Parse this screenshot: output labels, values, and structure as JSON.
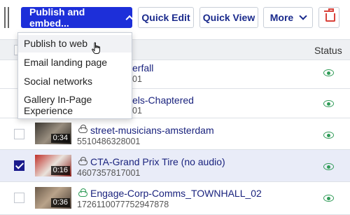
{
  "toolbar": {
    "publish_label": "Publish and embed...",
    "quick_edit_label": "Quick Edit",
    "quick_view_label": "Quick View",
    "more_label": "More"
  },
  "dropdown": {
    "items": [
      "Publish to web",
      "Email landing page",
      "Social networks",
      "Gallery In-Page Experience"
    ]
  },
  "table": {
    "status_header": "Status",
    "partial_rows": [
      {
        "title_fragment": "erfall",
        "id_fragment": "01"
      },
      {
        "title_fragment": "els-Chaptered",
        "id_fragment": "01"
      }
    ],
    "rows": [
      {
        "title": "street-musicians-amsterdam",
        "id": "5510486328001",
        "duration": "0:34",
        "selected": false
      },
      {
        "title": "CTA-Grand Prix Tire (no audio)",
        "id": "4607357817001",
        "duration": "0:16",
        "selected": true
      },
      {
        "title": "Engage-Corp-Comms_TOWNHALL_02",
        "id": "1726110077752947878",
        "duration": "0:36",
        "selected": false
      }
    ]
  },
  "colors": {
    "primary": "#1d2fd9",
    "link": "#1a237e",
    "status_green": "#2f9b57",
    "delete_red": "#d9433b",
    "selected_row": "#e9ecf8"
  },
  "icons": {
    "status": "eye-icon",
    "cloud": "cloud-icon",
    "delete": "trash-icon"
  }
}
